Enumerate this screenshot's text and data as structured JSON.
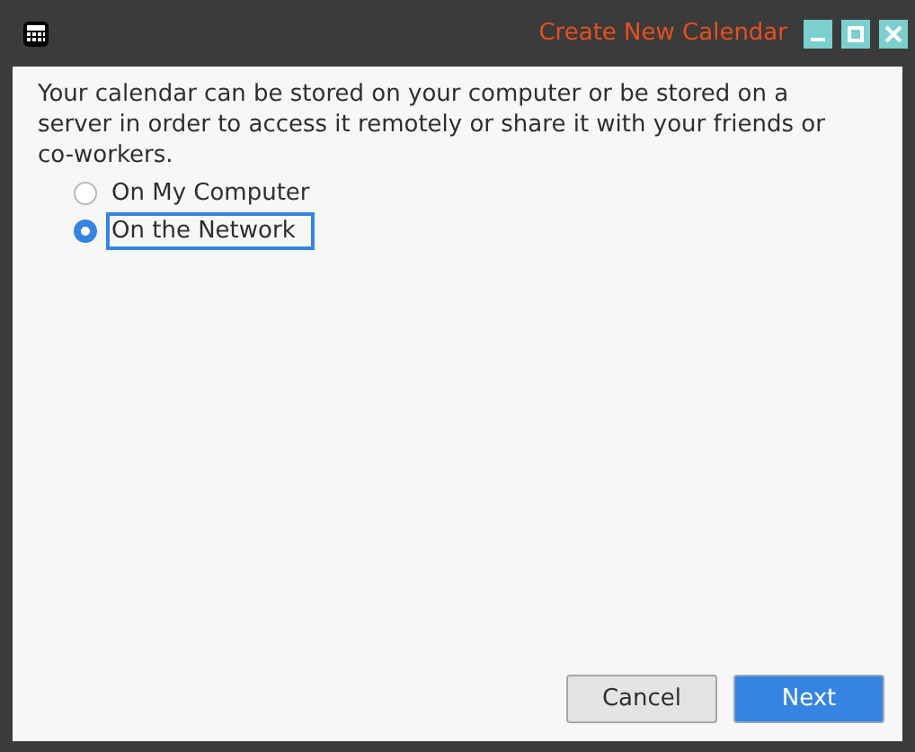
{
  "window": {
    "title": "Create New Calendar"
  },
  "description": "Your calendar can be stored on your computer or be stored on a server in order to access it remotely or share it with your friends or co-workers.",
  "options": [
    {
      "label": "On My Computer",
      "selected": false
    },
    {
      "label": "On the Network",
      "selected": true
    }
  ],
  "buttons": [
    {
      "label": "Cancel",
      "kind": "secondary"
    },
    {
      "label": "Next",
      "kind": "primary"
    }
  ]
}
